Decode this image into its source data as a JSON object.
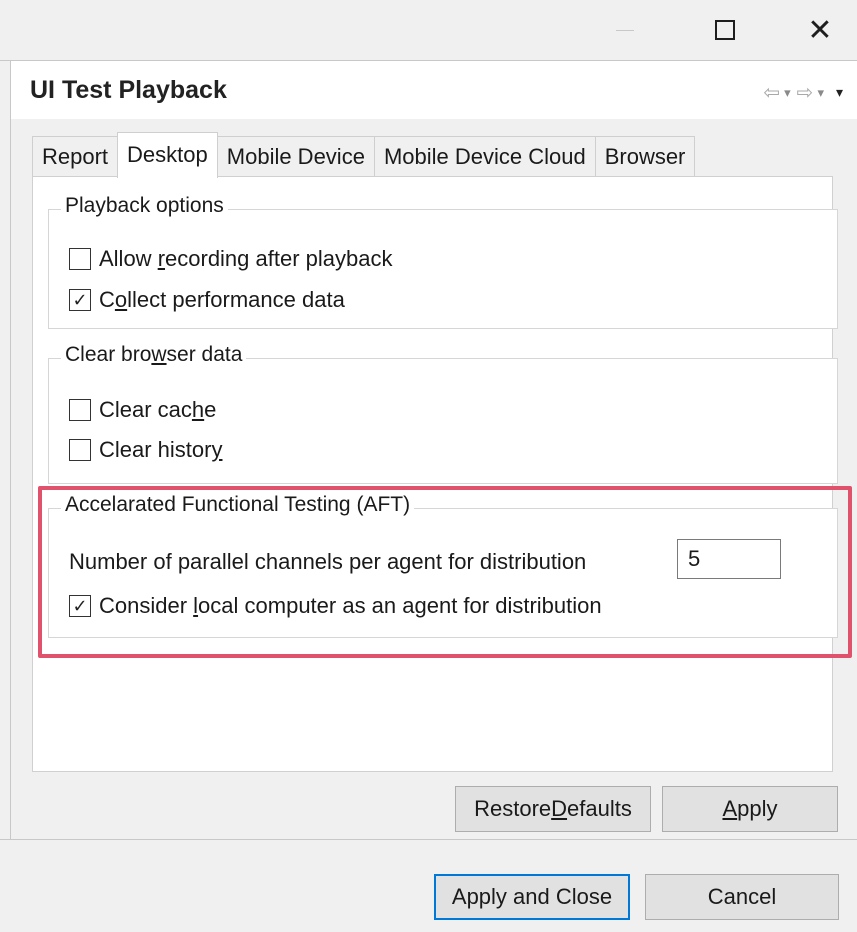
{
  "window": {
    "minimize_icon": "minimize-icon",
    "maximize_icon": "maximize-icon",
    "close_glyph": "✕"
  },
  "header": {
    "title": "UI Test Playback",
    "nav": {
      "back_glyph": "⇦",
      "forward_glyph": "⇨",
      "dropdown_glyph": "▾"
    }
  },
  "tabs": [
    {
      "label": "Report",
      "active": false
    },
    {
      "label": "Desktop",
      "active": true
    },
    {
      "label": "Mobile Device",
      "active": false
    },
    {
      "label": "Mobile Device Cloud",
      "active": false
    },
    {
      "label": "Browser",
      "active": false
    }
  ],
  "playback_options": {
    "legend": "Playback options",
    "allow_recording": {
      "pre": "Allow ",
      "key": "r",
      "post": "ecording after playback",
      "checked": false
    },
    "collect_performance": {
      "pre": "C",
      "key": "o",
      "post": "llect performance data",
      "checked": true
    }
  },
  "clear_browser_data": {
    "legend_pre": "Clear bro",
    "legend_key": "w",
    "legend_post": "ser data",
    "clear_cache": {
      "pre": "Clear cac",
      "key": "h",
      "post": "e",
      "checked": false
    },
    "clear_history": {
      "pre": "Clear histor",
      "key": "y",
      "post": "",
      "checked": false
    }
  },
  "aft": {
    "legend": "Accelarated Functional Testing (AFT)",
    "channels_label": "Number of parallel channels per agent for distribution",
    "channels_value": "5",
    "local_agent": {
      "pre": "Consider ",
      "key": "l",
      "post": "ocal computer as an agent for distribution",
      "checked": true
    }
  },
  "buttons": {
    "restore_pre": "Restore ",
    "restore_key": "D",
    "restore_post": "efaults",
    "apply_key": "A",
    "apply_post": "pply",
    "apply_and_close": "Apply and Close",
    "cancel": "Cancel"
  },
  "colors": {
    "highlight": "#e0526b",
    "focus": "#0078d7"
  },
  "check_glyph": "✓"
}
